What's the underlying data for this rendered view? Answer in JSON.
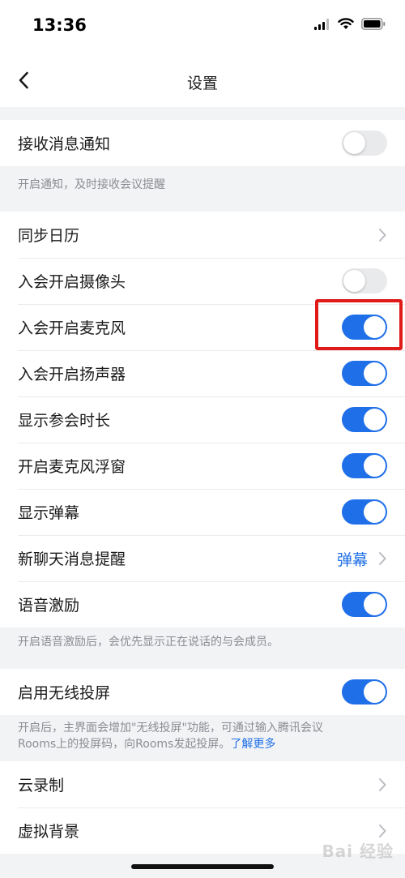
{
  "status_bar": {
    "time": "13:36"
  },
  "nav": {
    "title": "设置"
  },
  "groups": {
    "notify": {
      "label": "接收消息通知",
      "toggle_on": false,
      "note": "开启通知，及时接收会议提醒"
    },
    "meeting": {
      "sync_calendar": "同步日历",
      "camera": {
        "label": "入会开启摄像头",
        "toggle_on": false
      },
      "mic": {
        "label": "入会开启麦克风",
        "toggle_on": true
      },
      "speaker": {
        "label": "入会开启扬声器",
        "toggle_on": true
      },
      "duration": {
        "label": "显示参会时长",
        "toggle_on": true
      },
      "mic_float": {
        "label": "开启麦克风浮窗",
        "toggle_on": true
      },
      "barrage": {
        "label": "显示弹幕",
        "toggle_on": true
      },
      "chat_remind": {
        "label": "新聊天消息提醒",
        "value": "弹幕"
      },
      "voice_motivation": {
        "label": "语音激励",
        "toggle_on": true
      },
      "note": "开启语音激励后，会优先显示正在说话的与会成员。"
    },
    "wireless": {
      "label": "启用无线投屏",
      "toggle_on": true,
      "note_line1": "开启后，主界面会增加\"无线投屏\"功能，可通过输入腾讯会议",
      "note_line2": "Rooms上的投屏码，向Rooms发起投屏。",
      "note_link": "了解更多"
    },
    "more": {
      "cloud_record": "云录制",
      "virtual_bg": "虚拟背景"
    }
  },
  "watermark": "Bai 经验",
  "colors": {
    "accent": "#1f6fe8",
    "highlight": "#e01919"
  },
  "icons": [
    "signal-icon",
    "wifi-icon",
    "battery-icon",
    "back-icon",
    "chevron-right-icon"
  ]
}
